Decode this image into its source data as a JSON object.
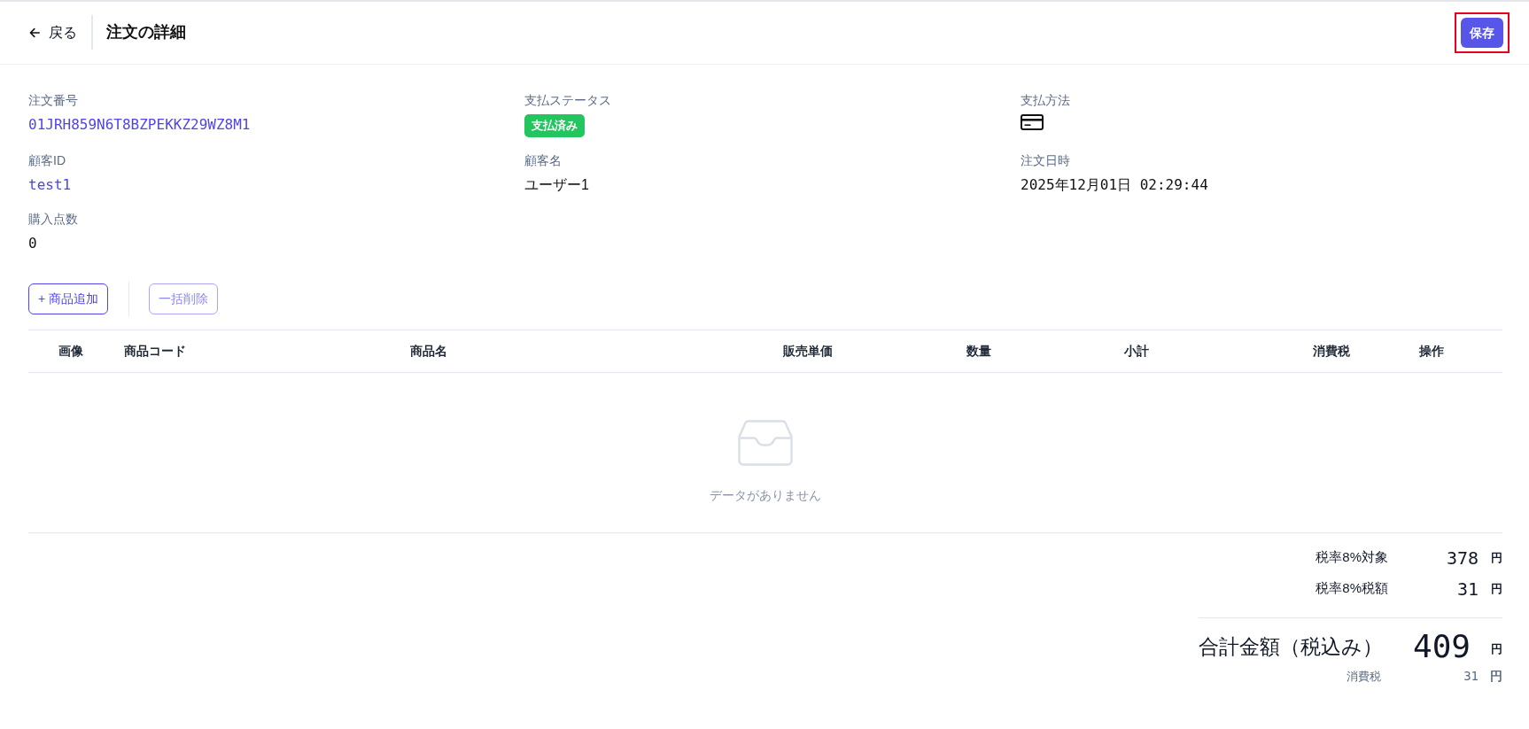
{
  "header": {
    "back_label": "戻る",
    "title": "注文の詳細",
    "save_button": {
      "label": "保存",
      "highlighted": true
    }
  },
  "order_info": [
    {
      "label": "注文番号",
      "value": "01JRH859N6T8BZPEKKZ29WZ8M1",
      "kind": "link"
    },
    {
      "label": "支払ステータス",
      "value": "支払済み",
      "kind": "badge"
    },
    {
      "label": "支払方法",
      "kind": "icon"
    },
    {
      "label": "顧客ID",
      "value": "test1",
      "kind": "link"
    },
    {
      "label": "顧客名",
      "value": "ユーザー1",
      "kind": "text"
    },
    {
      "label": "注文日時",
      "value": "2025年12月01日 02:29:44",
      "kind": "code"
    },
    {
      "label": "購入点数",
      "value": "0",
      "kind": "code"
    }
  ],
  "actions": [
    {
      "label": "+ 商品追加",
      "disabled": false
    },
    {
      "label": "一括削除",
      "disabled": true
    }
  ],
  "table": {
    "columns": [
      "画像",
      "商品コード",
      "商品名",
      "販売単価",
      "数量",
      "小計",
      "消費税",
      "操作"
    ],
    "empty_message": "データがありません"
  },
  "totals": [
    {
      "kind": "subtotal",
      "label": "税率8%対象",
      "amount": "378",
      "unit": "円"
    },
    {
      "kind": "subtotal",
      "label": "税率8%税額",
      "amount": "31",
      "unit": "円"
    },
    {
      "kind": "grand",
      "label": "合計金額（税込み）",
      "amount": "409",
      "unit": "円"
    },
    {
      "kind": "tax",
      "label": "消費税",
      "amount": "31",
      "unit": "円"
    }
  ]
}
